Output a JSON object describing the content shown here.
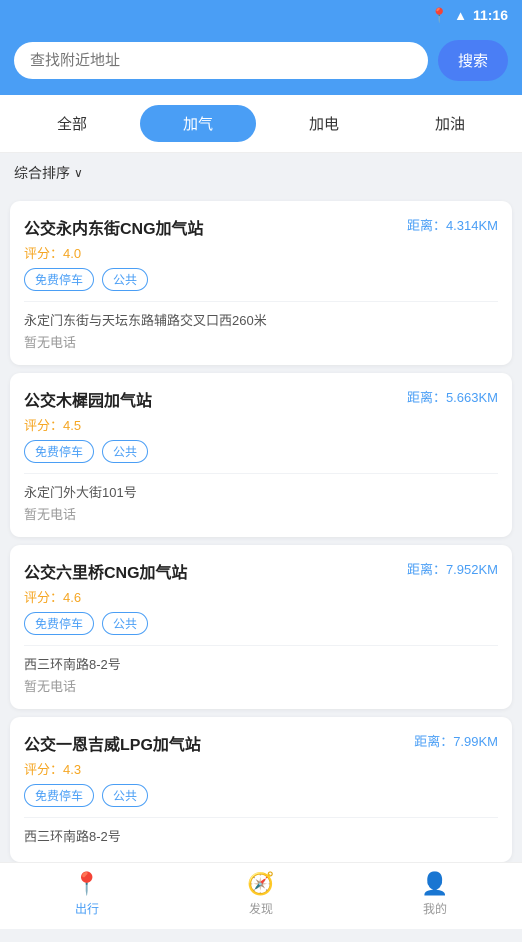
{
  "statusBar": {
    "time": "11:16"
  },
  "header": {
    "searchPlaceholder": "查找附近地址",
    "searchBtn": "搜索"
  },
  "tabs": [
    {
      "label": "全部",
      "active": false
    },
    {
      "label": "加气",
      "active": true
    },
    {
      "label": "加电",
      "active": false
    },
    {
      "label": "加油",
      "active": false
    }
  ],
  "sort": {
    "label": "综合排序"
  },
  "stations": [
    {
      "name": "公交永内东街CNG加气站",
      "distance": "距离：4.314KM",
      "rating": "评分：4.0",
      "tags": [
        "免费停车",
        "公共"
      ],
      "address": "永定门东街与天坛东路辅路交叉口西260米",
      "phone": "暂无电话"
    },
    {
      "name": "公交木樨园加气站",
      "distance": "距离：5.663KM",
      "rating": "评分：4.5",
      "tags": [
        "免费停车",
        "公共"
      ],
      "address": "永定门外大街101号",
      "phone": "暂无电话"
    },
    {
      "name": "公交六里桥CNG加气站",
      "distance": "距离：7.952KM",
      "rating": "评分：4.6",
      "tags": [
        "免费停车",
        "公共"
      ],
      "address": "西三环南路8-2号",
      "phone": "暂无电话"
    },
    {
      "name": "公交一恩吉威LPG加气站",
      "distance": "距离：7.99KM",
      "rating": "评分：4.3",
      "tags": [
        "免费停车",
        "公共"
      ],
      "address": "西三环南路8-2号",
      "phone": ""
    }
  ],
  "bottomNav": [
    {
      "label": "出行",
      "icon": "📍",
      "active": true
    },
    {
      "label": "发现",
      "icon": "🧭",
      "active": false
    },
    {
      "label": "我的",
      "icon": "👤",
      "active": false
    }
  ]
}
